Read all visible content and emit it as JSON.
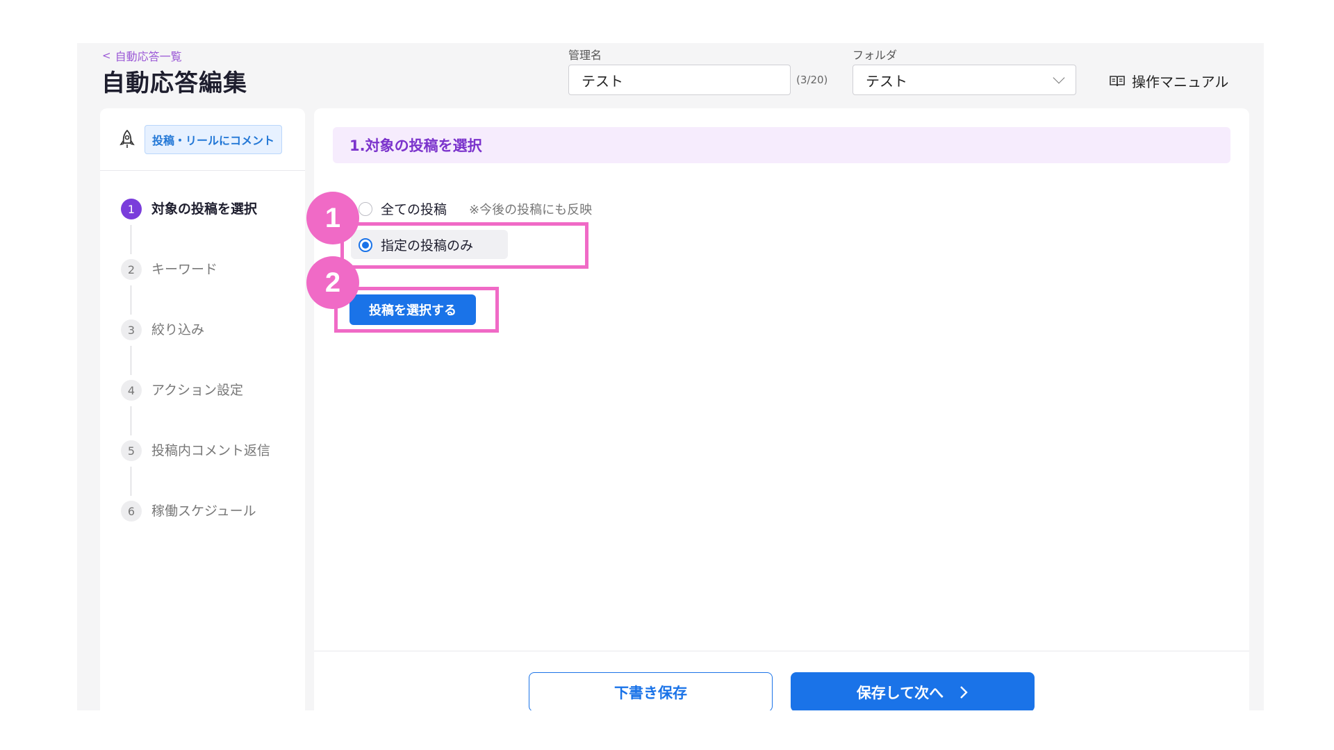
{
  "header": {
    "back_label": "自動応答一覧",
    "title": "自動応答編集",
    "name_label": "管理名",
    "name_value": "テスト",
    "name_counter": "(3/20)",
    "folder_label": "フォルダ",
    "folder_value": "テスト",
    "manual_label": "操作マニュアル"
  },
  "sidebar": {
    "chip_label": "投稿・リールにコメント",
    "steps": [
      {
        "num": "1",
        "label": "対象の投稿を選択"
      },
      {
        "num": "2",
        "label": "キーワード"
      },
      {
        "num": "3",
        "label": "絞り込み"
      },
      {
        "num": "4",
        "label": "アクション設定"
      },
      {
        "num": "5",
        "label": "投稿内コメント返信"
      },
      {
        "num": "6",
        "label": "稼働スケジュール"
      }
    ]
  },
  "main": {
    "section_title": "1.対象の投稿を選択",
    "radio_all_label": "全ての投稿",
    "radio_all_note": "※今後の投稿にも反映",
    "radio_specific_label": "指定の投稿のみ",
    "select_posts_button": "投稿を選択する",
    "draft_button": "下書き保存",
    "next_button": "保存して次へ"
  },
  "annotations": {
    "badge_1": "1",
    "badge_2": "2",
    "color": "#f06ac6"
  },
  "colors": {
    "accent_purple": "#7a3ddb",
    "primary_blue": "#1a73e8"
  }
}
